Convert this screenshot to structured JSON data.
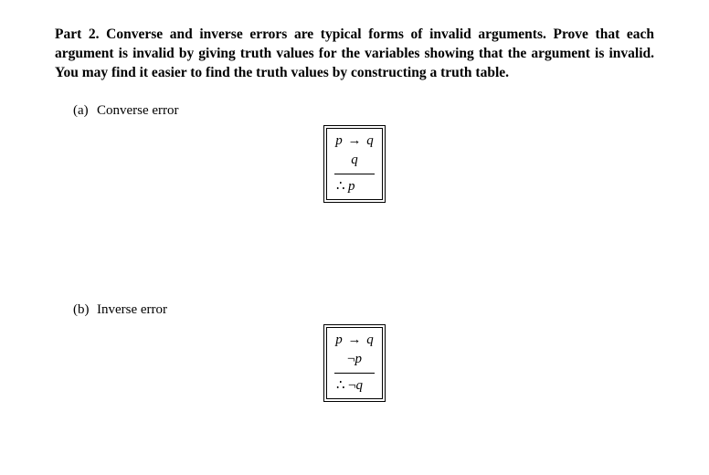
{
  "heading": "Part 2. Converse and inverse errors are typical forms of invalid arguments. Prove that each argument is invalid by giving truth values for the variables showing that the argument is invalid. You may find it easier to find the truth values by constructing a truth table.",
  "items": {
    "a": {
      "label": "(a)",
      "title": "Converse error",
      "premise1_left": "p",
      "premise1_arrow": "→",
      "premise1_right": "q",
      "premise2": "q",
      "therefore": "∴",
      "conclusion": "p"
    },
    "b": {
      "label": "(b)",
      "title": "Inverse error",
      "premise1_left": "p",
      "premise1_arrow": "→",
      "premise1_right": "q",
      "premise2_neg": "¬",
      "premise2_var": "p",
      "therefore": "∴",
      "conclusion_neg": "¬",
      "conclusion_var": "q"
    }
  }
}
